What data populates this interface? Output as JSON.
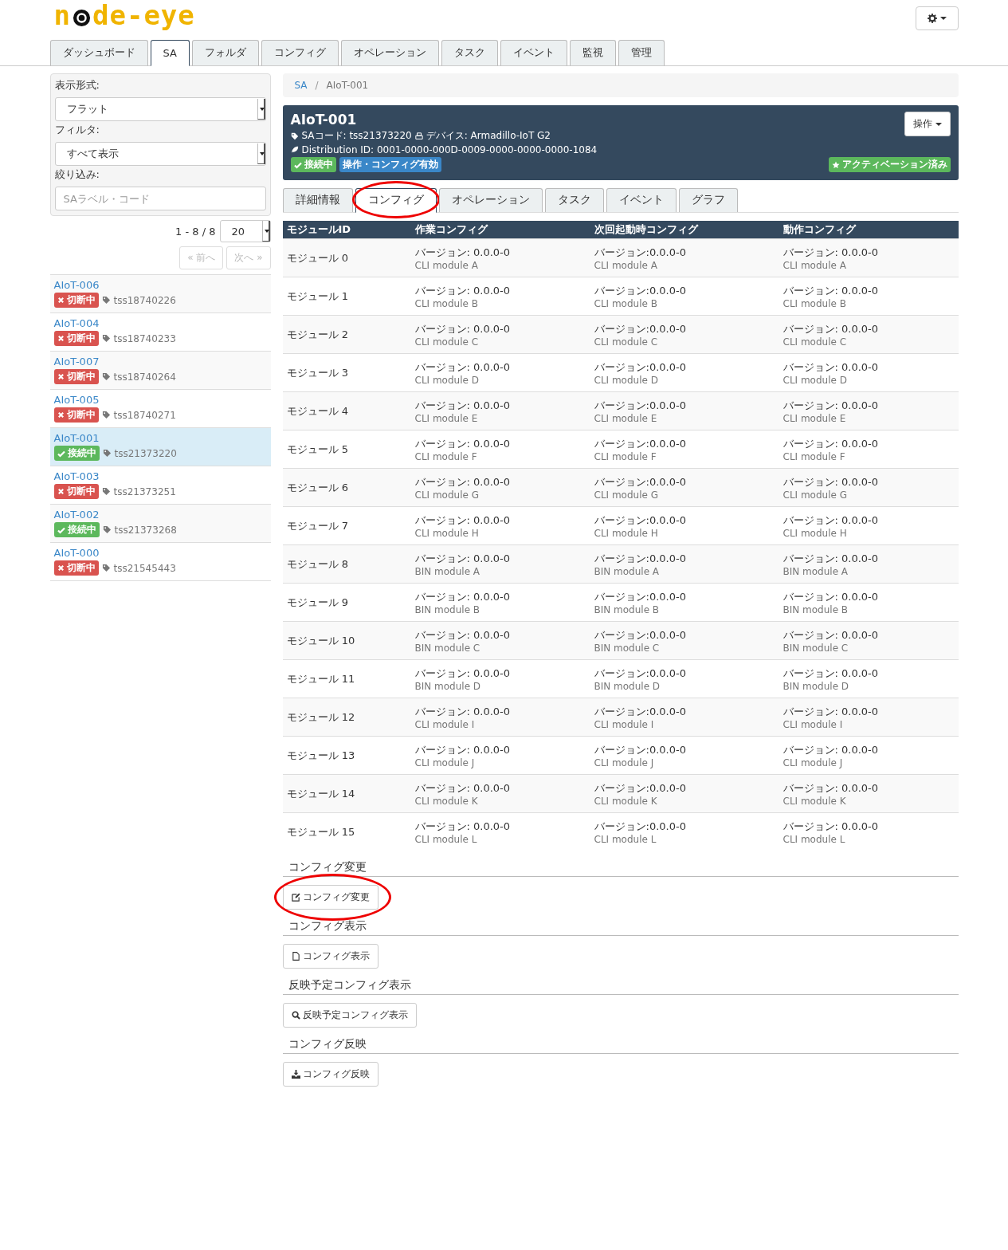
{
  "logo": {
    "before": "n",
    "after": "de-eye"
  },
  "nav_tabs": [
    {
      "label": "ダッシュボード",
      "selected": false
    },
    {
      "label": "SA",
      "selected": true
    },
    {
      "label": "フォルダ",
      "selected": false
    },
    {
      "label": "コンフィグ",
      "selected": false
    },
    {
      "label": "オペレーション",
      "selected": false
    },
    {
      "label": "タスク",
      "selected": false
    },
    {
      "label": "イベント",
      "selected": false
    },
    {
      "label": "監視",
      "selected": false
    },
    {
      "label": "管理",
      "selected": false
    }
  ],
  "sidebar": {
    "display_label": "表示形式:",
    "display_value": "フラット",
    "filter_label": "フィルタ:",
    "filter_value": "すべて表示",
    "search_label": "絞り込み:",
    "search_placeholder": "SAラベル・コード",
    "count": "1 - 8 / 8",
    "page_size": "20",
    "pager": [
      {
        "label": "« 前へ",
        "disabled": true
      },
      {
        "label": "次へ »",
        "disabled": true
      }
    ],
    "devices": [
      {
        "name": "AIoT-006",
        "kind": "disconnected",
        "status_label": "切断中",
        "code": "tss18740226",
        "selected": false
      },
      {
        "name": "AIoT-004",
        "kind": "disconnected",
        "status_label": "切断中",
        "code": "tss18740233",
        "selected": false
      },
      {
        "name": "AIoT-007",
        "kind": "disconnected",
        "status_label": "切断中",
        "code": "tss18740264",
        "selected": false
      },
      {
        "name": "AIoT-005",
        "kind": "disconnected",
        "status_label": "切断中",
        "code": "tss18740271",
        "selected": false
      },
      {
        "name": "AIoT-001",
        "kind": "connected",
        "status_label": "接続中",
        "code": "tss21373220",
        "selected": true
      },
      {
        "name": "AIoT-003",
        "kind": "disconnected",
        "status_label": "切断中",
        "code": "tss21373251",
        "selected": false
      },
      {
        "name": "AIoT-002",
        "kind": "connected",
        "status_label": "接続中",
        "code": "tss21373268",
        "selected": false
      },
      {
        "name": "AIoT-000",
        "kind": "disconnected",
        "status_label": "切断中",
        "code": "tss21545443",
        "selected": false
      }
    ]
  },
  "breadcrumb": {
    "separator": "/",
    "items": [
      {
        "label": "SA",
        "link": true
      },
      {
        "label": "AIoT-001",
        "link": false
      }
    ]
  },
  "device_header": {
    "title": "AIoT-001",
    "sa_code": "SAコード: tss21373220",
    "device": "デバイス: Armadillo-IoT G2",
    "distribution": "Distribution ID: 0001-0000-000D-0009-0000-0000-0000-1084",
    "badges": [
      {
        "label": "接続中",
        "kind": "connected"
      },
      {
        "label": "操作・コンフィグ有効",
        "kind": "info"
      }
    ],
    "activation": "アクティベーション済み",
    "action_button": "操作"
  },
  "detail_tabs": [
    {
      "label": "詳細情報",
      "selected": false,
      "highlighted": false
    },
    {
      "label": "コンフィグ",
      "selected": true,
      "highlighted": true
    },
    {
      "label": "オペレーション",
      "selected": false,
      "highlighted": false
    },
    {
      "label": "タスク",
      "selected": false,
      "highlighted": false
    },
    {
      "label": "イベント",
      "selected": false,
      "highlighted": false
    },
    {
      "label": "グラフ",
      "selected": false,
      "highlighted": false
    }
  ],
  "table": {
    "columns": [
      "モジュールID",
      "作業コンフィグ",
      "次回起動時コンフィグ",
      "動作コンフィグ"
    ],
    "rows": [
      {
        "module": "モジュール 0",
        "configs": [
          {
            "version": "バージョン: 0.0.0-0",
            "name": "CLI module A"
          },
          {
            "version": "バージョン:0.0.0-0",
            "name": "CLI module A"
          },
          {
            "version": "バージョン: 0.0.0-0",
            "name": "CLI module A"
          }
        ]
      },
      {
        "module": "モジュール 1",
        "configs": [
          {
            "version": "バージョン: 0.0.0-0",
            "name": "CLI module B"
          },
          {
            "version": "バージョン:0.0.0-0",
            "name": "CLI module B"
          },
          {
            "version": "バージョン: 0.0.0-0",
            "name": "CLI module B"
          }
        ]
      },
      {
        "module": "モジュール 2",
        "configs": [
          {
            "version": "バージョン: 0.0.0-0",
            "name": "CLI module C"
          },
          {
            "version": "バージョン:0.0.0-0",
            "name": "CLI module C"
          },
          {
            "version": "バージョン: 0.0.0-0",
            "name": "CLI module C"
          }
        ]
      },
      {
        "module": "モジュール 3",
        "configs": [
          {
            "version": "バージョン: 0.0.0-0",
            "name": "CLI module D"
          },
          {
            "version": "バージョン:0.0.0-0",
            "name": "CLI module D"
          },
          {
            "version": "バージョン: 0.0.0-0",
            "name": "CLI module D"
          }
        ]
      },
      {
        "module": "モジュール 4",
        "configs": [
          {
            "version": "バージョン: 0.0.0-0",
            "name": "CLI module E"
          },
          {
            "version": "バージョン:0.0.0-0",
            "name": "CLI module E"
          },
          {
            "version": "バージョン: 0.0.0-0",
            "name": "CLI module E"
          }
        ]
      },
      {
        "module": "モジュール 5",
        "configs": [
          {
            "version": "バージョン: 0.0.0-0",
            "name": "CLI module F"
          },
          {
            "version": "バージョン:0.0.0-0",
            "name": "CLI module F"
          },
          {
            "version": "バージョン: 0.0.0-0",
            "name": "CLI module F"
          }
        ]
      },
      {
        "module": "モジュール 6",
        "configs": [
          {
            "version": "バージョン: 0.0.0-0",
            "name": "CLI module G"
          },
          {
            "version": "バージョン:0.0.0-0",
            "name": "CLI module G"
          },
          {
            "version": "バージョン: 0.0.0-0",
            "name": "CLI module G"
          }
        ]
      },
      {
        "module": "モジュール 7",
        "configs": [
          {
            "version": "バージョン: 0.0.0-0",
            "name": "CLI module H"
          },
          {
            "version": "バージョン:0.0.0-0",
            "name": "CLI module H"
          },
          {
            "version": "バージョン: 0.0.0-0",
            "name": "CLI module H"
          }
        ]
      },
      {
        "module": "モジュール 8",
        "configs": [
          {
            "version": "バージョン: 0.0.0-0",
            "name": "BIN module A"
          },
          {
            "version": "バージョン:0.0.0-0",
            "name": "BIN module A"
          },
          {
            "version": "バージョン: 0.0.0-0",
            "name": "BIN module A"
          }
        ]
      },
      {
        "module": "モジュール 9",
        "configs": [
          {
            "version": "バージョン: 0.0.0-0",
            "name": "BIN module B"
          },
          {
            "version": "バージョン:0.0.0-0",
            "name": "BIN module B"
          },
          {
            "version": "バージョン: 0.0.0-0",
            "name": "BIN module B"
          }
        ]
      },
      {
        "module": "モジュール 10",
        "configs": [
          {
            "version": "バージョン: 0.0.0-0",
            "name": "BIN module C"
          },
          {
            "version": "バージョン:0.0.0-0",
            "name": "BIN module C"
          },
          {
            "version": "バージョン: 0.0.0-0",
            "name": "BIN module C"
          }
        ]
      },
      {
        "module": "モジュール 11",
        "configs": [
          {
            "version": "バージョン: 0.0.0-0",
            "name": "BIN module D"
          },
          {
            "version": "バージョン:0.0.0-0",
            "name": "BIN module D"
          },
          {
            "version": "バージョン: 0.0.0-0",
            "name": "BIN module D"
          }
        ]
      },
      {
        "module": "モジュール 12",
        "configs": [
          {
            "version": "バージョン: 0.0.0-0",
            "name": "CLI module I"
          },
          {
            "version": "バージョン:0.0.0-0",
            "name": "CLI module I"
          },
          {
            "version": "バージョン: 0.0.0-0",
            "name": "CLI module I"
          }
        ]
      },
      {
        "module": "モジュール 13",
        "configs": [
          {
            "version": "バージョン: 0.0.0-0",
            "name": "CLI module J"
          },
          {
            "version": "バージョン:0.0.0-0",
            "name": "CLI module J"
          },
          {
            "version": "バージョン: 0.0.0-0",
            "name": "CLI module J"
          }
        ]
      },
      {
        "module": "モジュール 14",
        "configs": [
          {
            "version": "バージョン: 0.0.0-0",
            "name": "CLI module K"
          },
          {
            "version": "バージョン:0.0.0-0",
            "name": "CLI module K"
          },
          {
            "version": "バージョン: 0.0.0-0",
            "name": "CLI module K"
          }
        ]
      },
      {
        "module": "モジュール 15",
        "configs": [
          {
            "version": "バージョン: 0.0.0-0",
            "name": "CLI module L"
          },
          {
            "version": "バージョン:0.0.0-0",
            "name": "CLI module L"
          },
          {
            "version": "バージョン: 0.0.0-0",
            "name": "CLI module L"
          }
        ]
      }
    ]
  },
  "sections": [
    {
      "heading": "コンフィグ変更",
      "button": "コンフィグ変更",
      "kind": "edit",
      "highlighted": true
    },
    {
      "heading": "コンフィグ表示",
      "button": "コンフィグ表示",
      "kind": "file",
      "highlighted": false
    },
    {
      "heading": "反映予定コンフィグ表示",
      "button": "反映予定コンフィグ表示",
      "kind": "search",
      "highlighted": false
    },
    {
      "heading": "コンフィグ反映",
      "button": "コンフィグ反映",
      "kind": "download",
      "highlighted": false
    }
  ]
}
